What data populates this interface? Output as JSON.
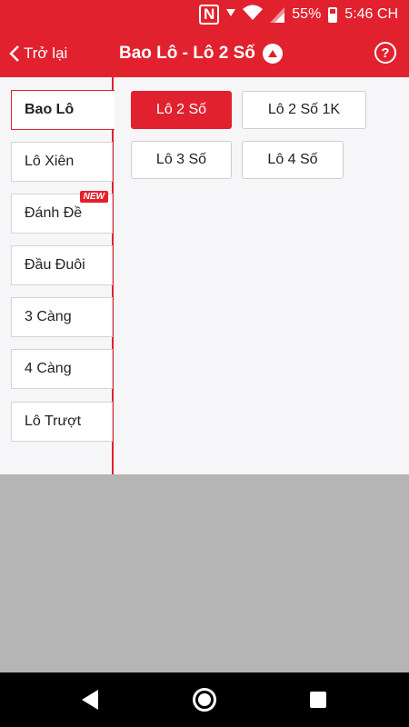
{
  "status_bar": {
    "nfc": "N",
    "battery_percent": "55%",
    "time": "5:46 CH",
    "icons": [
      "nfc-icon",
      "vibrate-icon",
      "wifi-icon",
      "signal-icon",
      "battery-icon"
    ]
  },
  "app_bar": {
    "back_label": "Trở lại",
    "title": "Bao Lô - Lô 2 Số",
    "help_symbol": "?"
  },
  "sidebar": {
    "items": [
      {
        "label": "Bao Lô",
        "active": true
      },
      {
        "label": "Lô Xiên"
      },
      {
        "label": "Đánh Đề",
        "badge": "NEW"
      },
      {
        "label": "Đầu Đuôi"
      },
      {
        "label": "3 Càng"
      },
      {
        "label": "4 Càng"
      },
      {
        "label": "Lô Trượt"
      }
    ]
  },
  "options": [
    {
      "label": "Lô 2 Số",
      "selected": true
    },
    {
      "label": "Lô 2 Số 1K"
    },
    {
      "label": "Lô 3 Số"
    },
    {
      "label": "Lô 4 Số"
    }
  ],
  "colors": {
    "accent": "#e2212e",
    "overlay": "#b5b5b5",
    "panel_background": "#f6f6f8"
  }
}
